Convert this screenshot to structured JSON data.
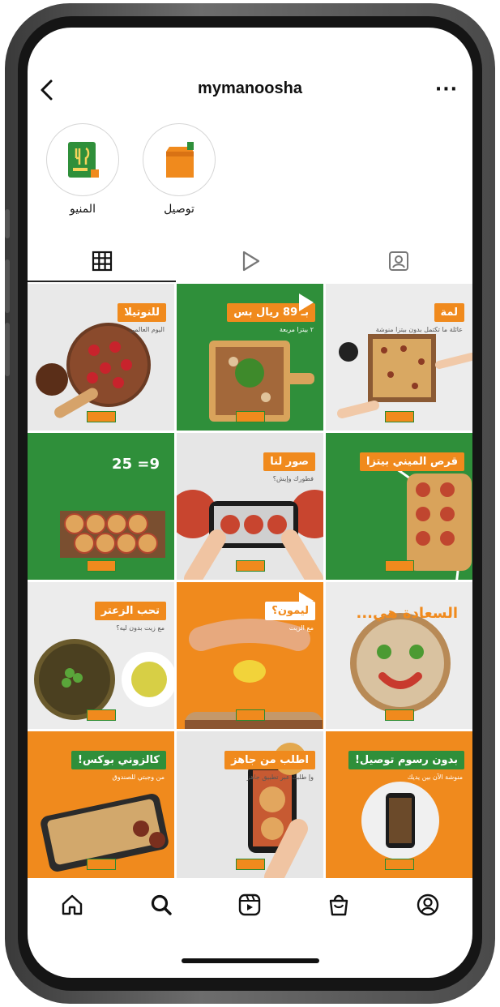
{
  "header": {
    "username": "mymanoosha",
    "more_label": "···"
  },
  "highlights": [
    {
      "label": "المنيو",
      "icon": "menu-book-icon"
    },
    {
      "label": "توصيل",
      "icon": "delivery-bag-icon"
    }
  ],
  "tabs": [
    {
      "name": "grid",
      "icon": "grid-icon",
      "active": true
    },
    {
      "name": "reels",
      "icon": "reels-play-icon",
      "active": false
    },
    {
      "name": "tagged",
      "icon": "tagged-user-icon",
      "active": false
    }
  ],
  "posts": [
    {
      "title": "للنوتيلا",
      "subtitle": "اليوم العالمي",
      "bg": "#e9e9e9",
      "title_bg": "#f08a1d",
      "art": "pizza-strawberry"
    },
    {
      "title": "بـ 89 ريال بس",
      "subtitle": "٢ بيتزا مربعة",
      "bg": "#2f8f3a",
      "title_bg": "#f08a1d",
      "art": "pizza-board",
      "video": true
    },
    {
      "title": "لمة",
      "subtitle": "عائلة ما تكتمل بدون بيتزا منوشة",
      "bg": "#ececec",
      "title_bg": "#f08a1d",
      "art": "square-pizza"
    },
    {
      "title": "9= 25",
      "subtitle": "",
      "bg": "#2f8f3a",
      "title_bg": "transparent",
      "art": "mini-pizzas"
    },
    {
      "title": "صور لنا",
      "subtitle": "فطورك وإيش؟",
      "bg": "#e6e6e6",
      "title_bg": "#f08a1d",
      "art": "phone-photo"
    },
    {
      "title": "قرص الميني بيتزا",
      "subtitle": "",
      "bg": "#2f8f3a",
      "title_bg": "#f08a1d",
      "art": "tray"
    },
    {
      "title": "تحب الزعتر",
      "subtitle": "مع زيت بدون ليه؟",
      "bg": "#ececec",
      "title_bg": "#f08a1d",
      "art": "zaatar"
    },
    {
      "title": "ليمون؟",
      "subtitle": "مع الزيت",
      "bg": "#f08a1d",
      "title_bg": "#ffffff",
      "art": "lemon",
      "video": true
    },
    {
      "title": "السعادة هي...",
      "subtitle": "",
      "bg": "#ececec",
      "title_bg": "transparent",
      "art": "smiley-pizza"
    },
    {
      "title": "كالزوني بوكس!",
      "subtitle": "من وجبتي للصندوق",
      "bg": "#f08a1d",
      "title_bg": "#2f8f3a",
      "art": "calzone"
    },
    {
      "title": "اطلب من جاهز",
      "subtitle": "وإ طلبك عبر تطبيق جاهز",
      "bg": "#e6e6e6",
      "title_bg": "#f08a1d",
      "art": "phone-hand"
    },
    {
      "title": "بدون رسوم توصيل!",
      "subtitle": "منوشة الآن بين يديك",
      "bg": "#f08a1d",
      "title_bg": "#2f8f3a",
      "art": "plate-phone"
    }
  ],
  "bottom_nav": [
    {
      "name": "home",
      "icon": "home-icon"
    },
    {
      "name": "search",
      "icon": "search-icon"
    },
    {
      "name": "reels",
      "icon": "reels-icon"
    },
    {
      "name": "shop",
      "icon": "shop-bag-icon"
    },
    {
      "name": "profile",
      "icon": "profile-icon"
    }
  ]
}
